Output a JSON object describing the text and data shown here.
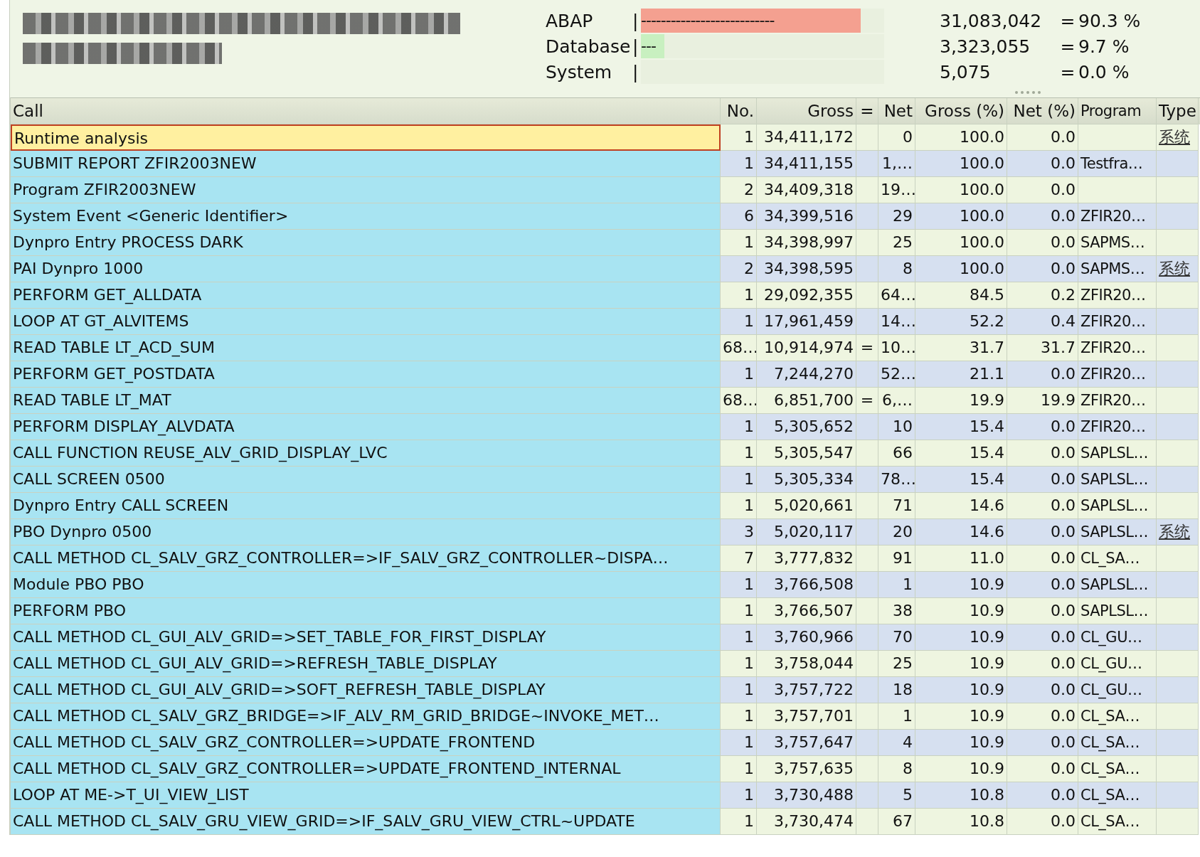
{
  "summary": [
    {
      "label": "ABAP",
      "separator": "|",
      "bar_text": "---------------------------",
      "color": "#f4a090",
      "level": 0.903,
      "value": "31,083,042",
      "eq": "=",
      "percent": "90.3 %"
    },
    {
      "label": "Database",
      "separator": "|",
      "bar_text": "---",
      "color": "#c8f0c0",
      "level": 0.097,
      "value": "3,323,055",
      "eq": "=",
      "percent": "9.7 %"
    },
    {
      "label": "System",
      "separator": "|",
      "value": "5,075",
      "eq": "=",
      "percent": "0.0 %"
    }
  ],
  "table": {
    "columns": [
      "Call",
      "No.",
      "Gross",
      "=",
      "Net",
      "Gross (%)",
      "Net (%)",
      "Program",
      "Type"
    ],
    "rows": [
      {
        "call": "Runtime analysis",
        "no": "1",
        "gross": "34,411,172",
        "net": "0",
        "gross_pct": "100.0",
        "net_pct": "0.0",
        "type": "系统",
        "selected": true
      },
      {
        "call": "SUBMIT REPORT ZFIR2003NEW",
        "no": "1",
        "gross": "34,411,155",
        "net": "1,…",
        "gross_pct": "100.0",
        "net_pct": "0.0",
        "program": "Testfra…",
        "selected": false
      },
      {
        "call": "Program ZFIR2003NEW",
        "no": "2",
        "gross": "34,409,318",
        "net": "19…",
        "gross_pct": "100.0",
        "net_pct": "0.0",
        "selected": false
      },
      {
        "call": "System Event <Generic Identifier>",
        "no": "6",
        "gross": "34,399,516",
        "net": "29",
        "gross_pct": "100.0",
        "net_pct": "0.0",
        "program": "ZFIR20…",
        "selected": false
      },
      {
        "call": "Dynpro Entry PROCESS DARK",
        "no": "1",
        "gross": "34,398,997",
        "net": "25",
        "gross_pct": "100.0",
        "net_pct": "0.0",
        "program": "SAPMS…",
        "selected": false
      },
      {
        "call": "PAI Dynpro 1000",
        "no": "2",
        "gross": "34,398,595",
        "net": "8",
        "gross_pct": "100.0",
        "net_pct": "0.0",
        "program": "SAPMS…",
        "type": "系统",
        "selected": false
      },
      {
        "call": "PERFORM GET_ALLDATA",
        "no": "1",
        "gross": "29,092,355",
        "net": "64…",
        "gross_pct": "84.5",
        "net_pct": "0.2",
        "program": "ZFIR20…",
        "selected": false
      },
      {
        "call": "LOOP AT GT_ALVITEMS",
        "no": "1",
        "gross": "17,961,459",
        "net": "14…",
        "gross_pct": "52.2",
        "net_pct": "0.4",
        "program": "ZFIR20…",
        "selected": false
      },
      {
        "call": "READ TABLE LT_ACD_SUM",
        "no": "68…",
        "gross": "10,914,974",
        "eq": "=",
        "net": "10…",
        "gross_pct": "31.7",
        "net_pct": "31.7",
        "program": "ZFIR20…",
        "selected": false
      },
      {
        "call": "PERFORM GET_POSTDATA",
        "no": "1",
        "gross": "7,244,270",
        "net": "52…",
        "gross_pct": "21.1",
        "net_pct": "0.0",
        "program": "ZFIR20…",
        "selected": false
      },
      {
        "call": "READ TABLE LT_MAT",
        "no": "68…",
        "gross": "6,851,700",
        "eq": "=",
        "net": "6,…",
        "gross_pct": "19.9",
        "net_pct": "19.9",
        "program": "ZFIR20…",
        "selected": false
      },
      {
        "call": "PERFORM DISPLAY_ALVDATA",
        "no": "1",
        "gross": "5,305,652",
        "net": "10",
        "gross_pct": "15.4",
        "net_pct": "0.0",
        "program": "ZFIR20…",
        "selected": false
      },
      {
        "call": "CALL FUNCTION REUSE_ALV_GRID_DISPLAY_LVC",
        "no": "1",
        "gross": "5,305,547",
        "net": "66",
        "gross_pct": "15.4",
        "net_pct": "0.0",
        "program": "SAPLSL…",
        "selected": false
      },
      {
        "call": "CALL SCREEN 0500",
        "no": "1",
        "gross": "5,305,334",
        "net": "78…",
        "gross_pct": "15.4",
        "net_pct": "0.0",
        "program": "SAPLSL…",
        "selected": false
      },
      {
        "call": "Dynpro Entry CALL SCREEN",
        "no": "1",
        "gross": "5,020,661",
        "net": "71",
        "gross_pct": "14.6",
        "net_pct": "0.0",
        "program": "SAPLSL…",
        "selected": false
      },
      {
        "call": "PBO Dynpro 0500",
        "no": "3",
        "gross": "5,020,117",
        "net": "20",
        "gross_pct": "14.6",
        "net_pct": "0.0",
        "program": "SAPLSL…",
        "type": "系统",
        "selected": false
      },
      {
        "call": "CALL METHOD CL_SALV_GRZ_CONTROLLER=>IF_SALV_GRZ_CONTROLLER~DISPA…",
        "no": "7",
        "gross": "3,777,832",
        "net": "91",
        "gross_pct": "11.0",
        "net_pct": "0.0",
        "program": "CL_SA…",
        "selected": false
      },
      {
        "call": "Module PBO PBO",
        "no": "1",
        "gross": "3,766,508",
        "net": "1",
        "gross_pct": "10.9",
        "net_pct": "0.0",
        "program": "SAPLSL…",
        "selected": false
      },
      {
        "call": "PERFORM PBO",
        "no": "1",
        "gross": "3,766,507",
        "net": "38",
        "gross_pct": "10.9",
        "net_pct": "0.0",
        "program": "SAPLSL…",
        "selected": false
      },
      {
        "call": "CALL METHOD CL_GUI_ALV_GRID=>SET_TABLE_FOR_FIRST_DISPLAY",
        "no": "1",
        "gross": "3,760,966",
        "net": "70",
        "gross_pct": "10.9",
        "net_pct": "0.0",
        "program": "CL_GU…",
        "selected": false
      },
      {
        "call": "CALL METHOD CL_GUI_ALV_GRID=>REFRESH_TABLE_DISPLAY",
        "no": "1",
        "gross": "3,758,044",
        "net": "25",
        "gross_pct": "10.9",
        "net_pct": "0.0",
        "program": "CL_GU…",
        "selected": false
      },
      {
        "call": "CALL METHOD CL_GUI_ALV_GRID=>SOFT_REFRESH_TABLE_DISPLAY",
        "no": "1",
        "gross": "3,757,722",
        "net": "18",
        "gross_pct": "10.9",
        "net_pct": "0.0",
        "program": "CL_GU…",
        "selected": false
      },
      {
        "call": "CALL METHOD CL_SALV_GRZ_BRIDGE=>IF_ALV_RM_GRID_BRIDGE~INVOKE_MET…",
        "no": "1",
        "gross": "3,757,701",
        "net": "1",
        "gross_pct": "10.9",
        "net_pct": "0.0",
        "program": "CL_SA…",
        "selected": false
      },
      {
        "call": "CALL METHOD CL_SALV_GRZ_CONTROLLER=>UPDATE_FRONTEND",
        "no": "1",
        "gross": "3,757,647",
        "net": "4",
        "gross_pct": "10.9",
        "net_pct": "0.0",
        "program": "CL_SA…",
        "selected": false
      },
      {
        "call": "CALL METHOD CL_SALV_GRZ_CONTROLLER=>UPDATE_FRONTEND_INTERNAL",
        "no": "1",
        "gross": "3,757,635",
        "net": "8",
        "gross_pct": "10.9",
        "net_pct": "0.0",
        "program": "CL_SA…",
        "selected": false
      },
      {
        "call": "LOOP AT ME->T_UI_VIEW_LIST",
        "no": "1",
        "gross": "3,730,488",
        "net": "5",
        "gross_pct": "10.8",
        "net_pct": "0.0",
        "program": "CL_SA…",
        "selected": false
      },
      {
        "call": "CALL METHOD CL_SALV_GRU_VIEW_GRID=>IF_SALV_GRU_VIEW_CTRL~UPDATE",
        "no": "1",
        "gross": "3,730,474",
        "net": "67",
        "gross_pct": "10.8",
        "net_pct": "0.0",
        "program": "CL_SA…",
        "selected": false
      }
    ]
  }
}
